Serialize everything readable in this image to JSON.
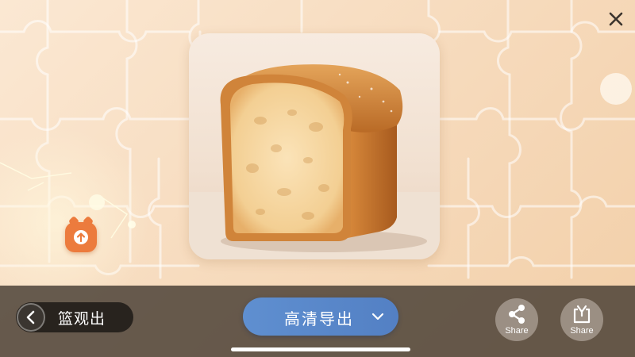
{
  "close": {
    "icon": "close-icon"
  },
  "product": {
    "image_subject": "bread-loaf-image"
  },
  "side_badge": {
    "icon": "upload-badge-icon",
    "color": "#ec7b3d"
  },
  "bottom_bar": {
    "back": {
      "icon": "chevron-left-icon",
      "label": "篮观出"
    },
    "export": {
      "label": "高清导出",
      "icon": "chevron-down-icon",
      "color": "#5a88cc"
    },
    "share_buttons": [
      {
        "icon": "share-network-icon",
        "label": "Share"
      },
      {
        "icon": "share-export-icon",
        "label": "Share"
      }
    ]
  },
  "colors": {
    "background": "#f7dcbf",
    "bar": "#463c32",
    "accent_blue": "#5a88cc",
    "accent_orange": "#ec7b3d"
  }
}
